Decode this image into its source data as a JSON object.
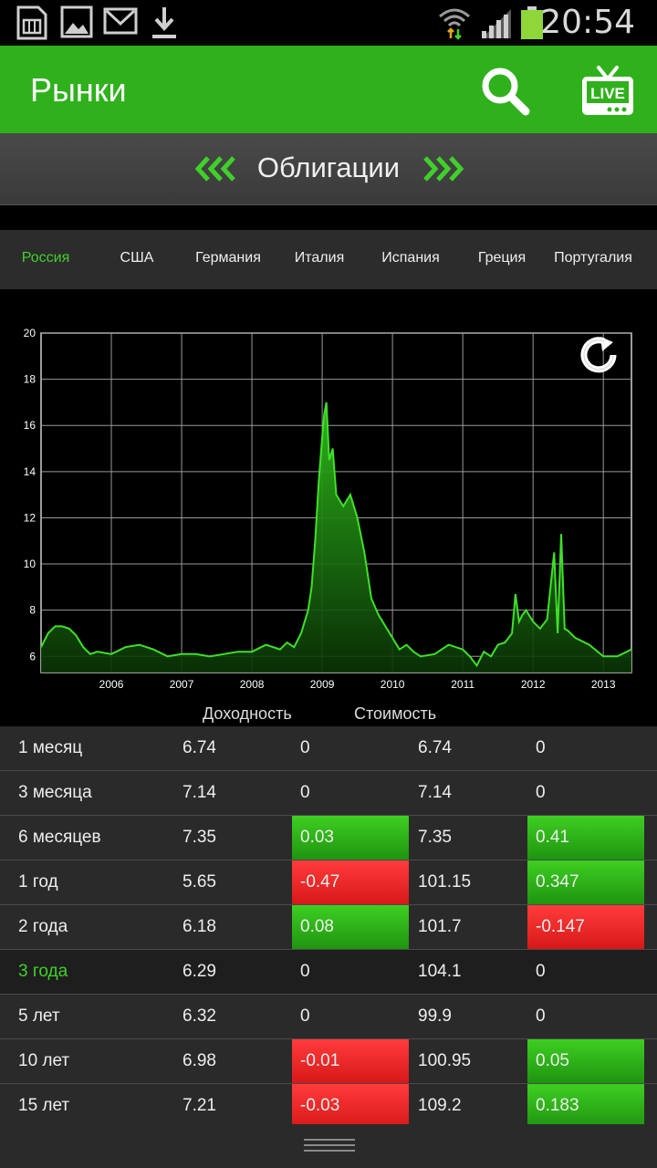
{
  "status_bar": {
    "time": "20:54"
  },
  "app_bar": {
    "title": "Рынки"
  },
  "section": {
    "title": "Облигации"
  },
  "countries": [
    {
      "label": "Россия",
      "active": true
    },
    {
      "label": "США",
      "active": false
    },
    {
      "label": "Германия",
      "active": false
    },
    {
      "label": "Италия",
      "active": false
    },
    {
      "label": "Испания",
      "active": false
    },
    {
      "label": "Греция",
      "active": false
    },
    {
      "label": "Португалия",
      "active": false
    }
  ],
  "chart_data": {
    "type": "area",
    "x_tick_labels": [
      "2006",
      "2007",
      "2008",
      "2009",
      "2010",
      "2011",
      "2012",
      "2013"
    ],
    "y_tick_labels": [
      "6",
      "8",
      "10",
      "12",
      "14",
      "16",
      "18",
      "20"
    ],
    "ylim": [
      5.3,
      20
    ],
    "xlim": [
      2005.0,
      2013.4
    ],
    "grid": true,
    "color": "#3fe02a",
    "x": [
      2005.0,
      2005.1,
      2005.2,
      2005.3,
      2005.4,
      2005.5,
      2005.6,
      2005.7,
      2005.8,
      2006.0,
      2006.2,
      2006.4,
      2006.6,
      2006.8,
      2007.0,
      2007.2,
      2007.4,
      2007.6,
      2007.8,
      2008.0,
      2008.2,
      2008.4,
      2008.5,
      2008.6,
      2008.7,
      2008.8,
      2008.85,
      2008.9,
      2008.95,
      2009.0,
      2009.03,
      2009.06,
      2009.1,
      2009.15,
      2009.2,
      2009.3,
      2009.4,
      2009.5,
      2009.6,
      2009.7,
      2009.8,
      2009.9,
      2010.0,
      2010.1,
      2010.2,
      2010.3,
      2010.4,
      2010.6,
      2010.8,
      2011.0,
      2011.1,
      2011.2,
      2011.3,
      2011.4,
      2011.5,
      2011.6,
      2011.7,
      2011.75,
      2011.8,
      2011.85,
      2011.9,
      2012.0,
      2012.1,
      2012.2,
      2012.3,
      2012.35,
      2012.4,
      2012.45,
      2012.5,
      2012.6,
      2012.8,
      2013.0,
      2013.2,
      2013.4
    ],
    "y": [
      6.4,
      7.0,
      7.3,
      7.3,
      7.2,
      6.9,
      6.4,
      6.1,
      6.2,
      6.1,
      6.4,
      6.5,
      6.3,
      6.0,
      6.1,
      6.1,
      6.0,
      6.1,
      6.2,
      6.2,
      6.5,
      6.3,
      6.6,
      6.4,
      7.0,
      8.0,
      9.0,
      11.0,
      13.5,
      15.5,
      16.5,
      17.0,
      14.5,
      15.0,
      13.0,
      12.5,
      13.0,
      12.0,
      10.5,
      8.5,
      7.8,
      7.3,
      6.8,
      6.3,
      6.5,
      6.2,
      6.0,
      6.1,
      6.5,
      6.3,
      6.0,
      5.6,
      6.2,
      6.0,
      6.5,
      6.6,
      7.0,
      8.7,
      7.5,
      7.8,
      8.0,
      7.5,
      7.2,
      7.6,
      10.5,
      7.0,
      11.3,
      7.2,
      7.1,
      6.8,
      6.5,
      6.0,
      6.0,
      6.3
    ]
  },
  "table": {
    "header_yield": "Доходность",
    "header_price": "Стоимость",
    "rows": [
      {
        "label": "1 месяц",
        "yield": "6.74",
        "yield_change": "0",
        "yield_dir": "none",
        "price": "6.74",
        "price_change": "0",
        "price_dir": "none"
      },
      {
        "label": "3 месяца",
        "yield": "7.14",
        "yield_change": "0",
        "yield_dir": "none",
        "price": "7.14",
        "price_change": "0",
        "price_dir": "none"
      },
      {
        "label": "6 месяцев",
        "yield": "7.35",
        "yield_change": "0.03",
        "yield_dir": "pos",
        "price": "7.35",
        "price_change": "0.41",
        "price_dir": "pos"
      },
      {
        "label": "1 год",
        "yield": "5.65",
        "yield_change": "-0.47",
        "yield_dir": "neg",
        "price": "101.15",
        "price_change": "0.347",
        "price_dir": "pos"
      },
      {
        "label": "2 года",
        "yield": "6.18",
        "yield_change": "0.08",
        "yield_dir": "pos",
        "price": "101.7",
        "price_change": "-0.147",
        "price_dir": "neg"
      },
      {
        "label": "3 года",
        "yield": "6.29",
        "yield_change": "0",
        "yield_dir": "none",
        "price": "104.1",
        "price_change": "0",
        "price_dir": "none",
        "selected": true
      },
      {
        "label": "5 лет",
        "yield": "6.32",
        "yield_change": "0",
        "yield_dir": "none",
        "price": "99.9",
        "price_change": "0",
        "price_dir": "none"
      },
      {
        "label": "10 лет",
        "yield": "6.98",
        "yield_change": "-0.01",
        "yield_dir": "neg",
        "price": "100.95",
        "price_change": "0.05",
        "price_dir": "pos"
      },
      {
        "label": "15 лет",
        "yield": "7.21",
        "yield_change": "-0.03",
        "yield_dir": "neg",
        "price": "109.2",
        "price_change": "0.183",
        "price_dir": "pos"
      }
    ]
  },
  "icons": {
    "status": [
      "sim-card-icon",
      "image-icon",
      "mail-icon",
      "download-icon",
      "wifi-icon",
      "signal-icon",
      "battery-icon"
    ],
    "app_bar": [
      "search-icon",
      "live-tv-icon"
    ],
    "chart": "refresh-icon"
  },
  "colors": {
    "accent": "#2fb11c",
    "positive": "#2fbf1a",
    "negative": "#f02a2a"
  }
}
